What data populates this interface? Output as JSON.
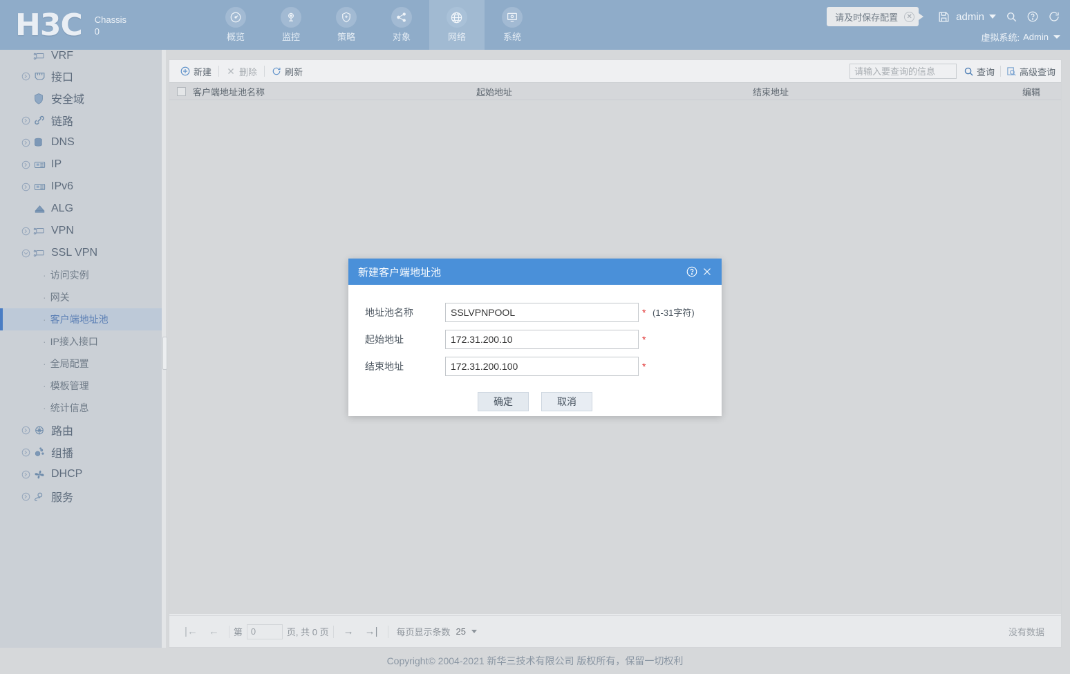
{
  "header": {
    "logo": "H3C",
    "chassis_label": "Chassis",
    "chassis_value": "0",
    "nav": [
      {
        "label": "概览",
        "icon": "gauge-icon",
        "active": false
      },
      {
        "label": "监控",
        "icon": "camera-icon",
        "active": false
      },
      {
        "label": "策略",
        "icon": "shield-plus-icon",
        "active": false
      },
      {
        "label": "对象",
        "icon": "share-nodes-icon",
        "active": false
      },
      {
        "label": "网络",
        "icon": "globe-icon",
        "active": true
      },
      {
        "label": "系统",
        "icon": "monitor-gear-icon",
        "active": false
      }
    ],
    "save_tip": "请及时保存配置",
    "user": "admin",
    "vsys_label": "虚拟系统:",
    "vsys_value": "Admin",
    "icons": [
      "save-icon",
      "search-icon",
      "help-icon",
      "logout-icon"
    ]
  },
  "sidebar": {
    "items": [
      {
        "label": "VRF",
        "icon": "vrf-icon",
        "expandable": false,
        "indent": true
      },
      {
        "label": "接口",
        "icon": "interface-icon",
        "expandable": true
      },
      {
        "label": "安全域",
        "icon": "shield-icon",
        "expandable": false,
        "indent": true
      },
      {
        "label": "链路",
        "icon": "link-icon",
        "expandable": true
      },
      {
        "label": "DNS",
        "icon": "dns-icon",
        "expandable": true
      },
      {
        "label": "IP",
        "icon": "ip-icon",
        "expandable": true
      },
      {
        "label": "IPv6",
        "icon": "ipv6-icon",
        "expandable": true
      },
      {
        "label": "ALG",
        "icon": "alg-icon",
        "expandable": false,
        "indent": true
      },
      {
        "label": "VPN",
        "icon": "vpn-icon",
        "expandable": true
      },
      {
        "label": "SSL VPN",
        "icon": "sslvpn-icon",
        "expandable": true,
        "expanded": true
      }
    ],
    "subitems": [
      {
        "label": "访问实例",
        "selected": false
      },
      {
        "label": "网关",
        "selected": false
      },
      {
        "label": "客户端地址池",
        "selected": true
      },
      {
        "label": "IP接入接口",
        "selected": false
      },
      {
        "label": "全局配置",
        "selected": false
      },
      {
        "label": "模板管理",
        "selected": false
      },
      {
        "label": "统计信息",
        "selected": false
      }
    ],
    "items_after": [
      {
        "label": "路由",
        "icon": "route-icon",
        "expandable": true
      },
      {
        "label": "组播",
        "icon": "multicast-icon",
        "expandable": true
      },
      {
        "label": "DHCP",
        "icon": "dhcp-icon",
        "expandable": true
      },
      {
        "label": "服务",
        "icon": "service-icon",
        "expandable": true
      }
    ]
  },
  "toolbar": {
    "new_label": "新建",
    "delete_label": "删除",
    "refresh_label": "刷新",
    "search_placeholder": "请输入要查询的信息",
    "query_label": "查询",
    "advanced_query_label": "高级查询"
  },
  "table": {
    "columns": [
      "客户端地址池名称",
      "起始地址",
      "结束地址",
      "编辑"
    ],
    "rows": []
  },
  "pager": {
    "page_prefix": "第",
    "page_value": "0",
    "page_suffix": "页,  共 0 页",
    "per_page_label": "每页显示条数",
    "per_page_value": "25",
    "no_data": "没有数据"
  },
  "modal": {
    "title": "新建客户端地址池",
    "fields": [
      {
        "label": "地址池名称",
        "value": "SSLVPNPOOL",
        "required": "*",
        "hint": "(1-31字符)"
      },
      {
        "label": "起始地址",
        "value": "172.31.200.10",
        "required": "*",
        "hint": ""
      },
      {
        "label": "结束地址",
        "value": "172.31.200.100",
        "required": "*",
        "hint": ""
      }
    ],
    "ok_label": "确定",
    "cancel_label": "取消"
  },
  "footer": {
    "copyright": "Copyright© 2004-2021 新华三技术有限公司 版权所有，保留一切权利"
  },
  "colors": {
    "header_bg": "#8facc9",
    "sidebar_bg": "#cbd0d6",
    "modal_header": "#4a90d9",
    "selected_item": "#5b7fb5",
    "required_star": "#e03030"
  }
}
